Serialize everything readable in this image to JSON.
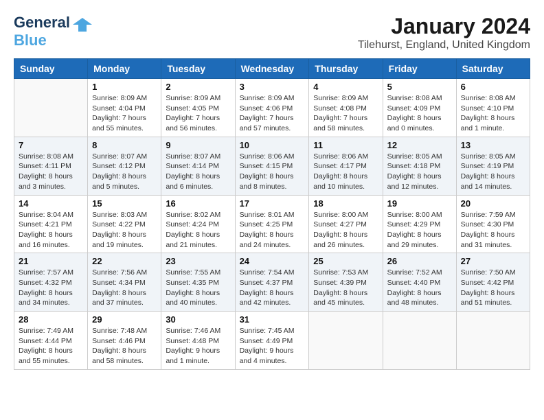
{
  "logo": {
    "line1": "General",
    "line2": "Blue"
  },
  "title": "January 2024",
  "subtitle": "Tilehurst, England, United Kingdom",
  "weekdays": [
    "Sunday",
    "Monday",
    "Tuesday",
    "Wednesday",
    "Thursday",
    "Friday",
    "Saturday"
  ],
  "weeks": [
    [
      {
        "num": "",
        "sunrise": "",
        "sunset": "",
        "daylight": ""
      },
      {
        "num": "1",
        "sunrise": "Sunrise: 8:09 AM",
        "sunset": "Sunset: 4:04 PM",
        "daylight": "Daylight: 7 hours and 55 minutes."
      },
      {
        "num": "2",
        "sunrise": "Sunrise: 8:09 AM",
        "sunset": "Sunset: 4:05 PM",
        "daylight": "Daylight: 7 hours and 56 minutes."
      },
      {
        "num": "3",
        "sunrise": "Sunrise: 8:09 AM",
        "sunset": "Sunset: 4:06 PM",
        "daylight": "Daylight: 7 hours and 57 minutes."
      },
      {
        "num": "4",
        "sunrise": "Sunrise: 8:09 AM",
        "sunset": "Sunset: 4:08 PM",
        "daylight": "Daylight: 7 hours and 58 minutes."
      },
      {
        "num": "5",
        "sunrise": "Sunrise: 8:08 AM",
        "sunset": "Sunset: 4:09 PM",
        "daylight": "Daylight: 8 hours and 0 minutes."
      },
      {
        "num": "6",
        "sunrise": "Sunrise: 8:08 AM",
        "sunset": "Sunset: 4:10 PM",
        "daylight": "Daylight: 8 hours and 1 minute."
      }
    ],
    [
      {
        "num": "7",
        "sunrise": "Sunrise: 8:08 AM",
        "sunset": "Sunset: 4:11 PM",
        "daylight": "Daylight: 8 hours and 3 minutes."
      },
      {
        "num": "8",
        "sunrise": "Sunrise: 8:07 AM",
        "sunset": "Sunset: 4:12 PM",
        "daylight": "Daylight: 8 hours and 5 minutes."
      },
      {
        "num": "9",
        "sunrise": "Sunrise: 8:07 AM",
        "sunset": "Sunset: 4:14 PM",
        "daylight": "Daylight: 8 hours and 6 minutes."
      },
      {
        "num": "10",
        "sunrise": "Sunrise: 8:06 AM",
        "sunset": "Sunset: 4:15 PM",
        "daylight": "Daylight: 8 hours and 8 minutes."
      },
      {
        "num": "11",
        "sunrise": "Sunrise: 8:06 AM",
        "sunset": "Sunset: 4:17 PM",
        "daylight": "Daylight: 8 hours and 10 minutes."
      },
      {
        "num": "12",
        "sunrise": "Sunrise: 8:05 AM",
        "sunset": "Sunset: 4:18 PM",
        "daylight": "Daylight: 8 hours and 12 minutes."
      },
      {
        "num": "13",
        "sunrise": "Sunrise: 8:05 AM",
        "sunset": "Sunset: 4:19 PM",
        "daylight": "Daylight: 8 hours and 14 minutes."
      }
    ],
    [
      {
        "num": "14",
        "sunrise": "Sunrise: 8:04 AM",
        "sunset": "Sunset: 4:21 PM",
        "daylight": "Daylight: 8 hours and 16 minutes."
      },
      {
        "num": "15",
        "sunrise": "Sunrise: 8:03 AM",
        "sunset": "Sunset: 4:22 PM",
        "daylight": "Daylight: 8 hours and 19 minutes."
      },
      {
        "num": "16",
        "sunrise": "Sunrise: 8:02 AM",
        "sunset": "Sunset: 4:24 PM",
        "daylight": "Daylight: 8 hours and 21 minutes."
      },
      {
        "num": "17",
        "sunrise": "Sunrise: 8:01 AM",
        "sunset": "Sunset: 4:25 PM",
        "daylight": "Daylight: 8 hours and 24 minutes."
      },
      {
        "num": "18",
        "sunrise": "Sunrise: 8:00 AM",
        "sunset": "Sunset: 4:27 PM",
        "daylight": "Daylight: 8 hours and 26 minutes."
      },
      {
        "num": "19",
        "sunrise": "Sunrise: 8:00 AM",
        "sunset": "Sunset: 4:29 PM",
        "daylight": "Daylight: 8 hours and 29 minutes."
      },
      {
        "num": "20",
        "sunrise": "Sunrise: 7:59 AM",
        "sunset": "Sunset: 4:30 PM",
        "daylight": "Daylight: 8 hours and 31 minutes."
      }
    ],
    [
      {
        "num": "21",
        "sunrise": "Sunrise: 7:57 AM",
        "sunset": "Sunset: 4:32 PM",
        "daylight": "Daylight: 8 hours and 34 minutes."
      },
      {
        "num": "22",
        "sunrise": "Sunrise: 7:56 AM",
        "sunset": "Sunset: 4:34 PM",
        "daylight": "Daylight: 8 hours and 37 minutes."
      },
      {
        "num": "23",
        "sunrise": "Sunrise: 7:55 AM",
        "sunset": "Sunset: 4:35 PM",
        "daylight": "Daylight: 8 hours and 40 minutes."
      },
      {
        "num": "24",
        "sunrise": "Sunrise: 7:54 AM",
        "sunset": "Sunset: 4:37 PM",
        "daylight": "Daylight: 8 hours and 42 minutes."
      },
      {
        "num": "25",
        "sunrise": "Sunrise: 7:53 AM",
        "sunset": "Sunset: 4:39 PM",
        "daylight": "Daylight: 8 hours and 45 minutes."
      },
      {
        "num": "26",
        "sunrise": "Sunrise: 7:52 AM",
        "sunset": "Sunset: 4:40 PM",
        "daylight": "Daylight: 8 hours and 48 minutes."
      },
      {
        "num": "27",
        "sunrise": "Sunrise: 7:50 AM",
        "sunset": "Sunset: 4:42 PM",
        "daylight": "Daylight: 8 hours and 51 minutes."
      }
    ],
    [
      {
        "num": "28",
        "sunrise": "Sunrise: 7:49 AM",
        "sunset": "Sunset: 4:44 PM",
        "daylight": "Daylight: 8 hours and 55 minutes."
      },
      {
        "num": "29",
        "sunrise": "Sunrise: 7:48 AM",
        "sunset": "Sunset: 4:46 PM",
        "daylight": "Daylight: 8 hours and 58 minutes."
      },
      {
        "num": "30",
        "sunrise": "Sunrise: 7:46 AM",
        "sunset": "Sunset: 4:48 PM",
        "daylight": "Daylight: 9 hours and 1 minute."
      },
      {
        "num": "31",
        "sunrise": "Sunrise: 7:45 AM",
        "sunset": "Sunset: 4:49 PM",
        "daylight": "Daylight: 9 hours and 4 minutes."
      },
      {
        "num": "",
        "sunrise": "",
        "sunset": "",
        "daylight": ""
      },
      {
        "num": "",
        "sunrise": "",
        "sunset": "",
        "daylight": ""
      },
      {
        "num": "",
        "sunrise": "",
        "sunset": "",
        "daylight": ""
      }
    ]
  ]
}
